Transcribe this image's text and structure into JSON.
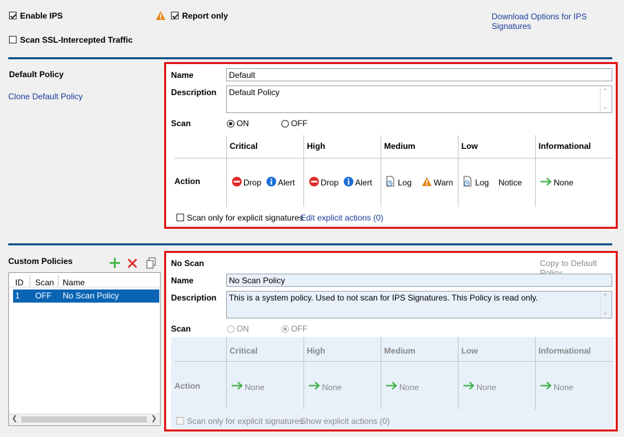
{
  "top": {
    "enable_ips": "Enable IPS",
    "report_only": "Report only",
    "download_link": "Download Options for IPS Signatures",
    "scan_ssl": "Scan SSL-Intercepted Traffic"
  },
  "default_section": {
    "title": "Default Policy",
    "clone_link": "Clone Default Policy"
  },
  "default_policy": {
    "name_label": "Name",
    "name_value": "Default",
    "desc_label": "Description",
    "desc_value": "Default Policy",
    "scan_label": "Scan",
    "on_label": "ON",
    "off_label": "OFF",
    "severities": [
      "Critical",
      "High",
      "Medium",
      "Low",
      "Informational"
    ],
    "action_label": "Action",
    "actions": {
      "critical_a": "Drop",
      "critical_b": "Alert",
      "high_a": "Drop",
      "high_b": "Alert",
      "medium_a": "Log",
      "medium_b": "Warn",
      "low_a": "Log",
      "low_b": "Notice",
      "info_a": "None"
    },
    "explicit_label": "Scan only for explicit signatures",
    "explicit_link": "Edit explicit actions (0)"
  },
  "custom_section": {
    "title": "Custom Policies",
    "columns": [
      "ID",
      "Scan",
      "Name"
    ],
    "row": {
      "id": "1",
      "scan": "OFF",
      "name": "No Scan Policy"
    }
  },
  "noscan_policy": {
    "title": "No Scan",
    "copy_link": "Copy to Default Policy",
    "name_label": "Name",
    "name_value": "No Scan Policy",
    "desc_label": "Description",
    "desc_value": "This is a system policy. Used to not scan for IPS Signatures. This Policy is read only.",
    "scan_label": "Scan",
    "on_label": "ON",
    "off_label": "OFF",
    "severities": [
      "Critical",
      "High",
      "Medium",
      "Low",
      "Informational"
    ],
    "action_label": "Action",
    "none_label": "None",
    "explicit_label": "Scan only for explicit signatures",
    "explicit_link": "Show explicit actions (0)"
  },
  "colors": {
    "accent_bar": "#0f5289",
    "highlight_border": "#e01b1b",
    "selection": "#0a64b4"
  }
}
